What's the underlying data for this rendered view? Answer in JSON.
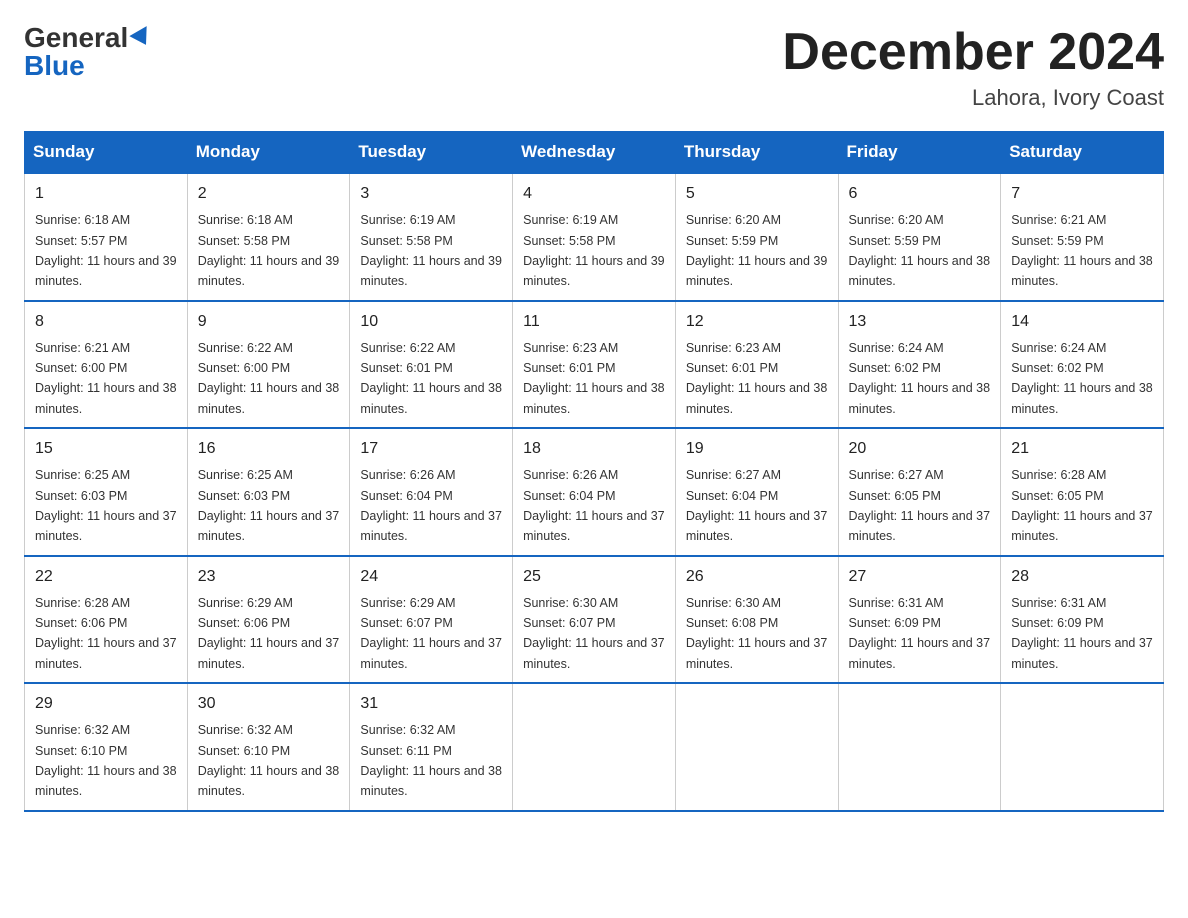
{
  "header": {
    "logo_general": "General",
    "logo_blue": "Blue",
    "month_title": "December 2024",
    "location": "Lahora, Ivory Coast"
  },
  "weekdays": [
    "Sunday",
    "Monday",
    "Tuesday",
    "Wednesday",
    "Thursday",
    "Friday",
    "Saturday"
  ],
  "weeks": [
    [
      {
        "day": "1",
        "sunrise": "6:18 AM",
        "sunset": "5:57 PM",
        "daylight": "11 hours and 39 minutes."
      },
      {
        "day": "2",
        "sunrise": "6:18 AM",
        "sunset": "5:58 PM",
        "daylight": "11 hours and 39 minutes."
      },
      {
        "day": "3",
        "sunrise": "6:19 AM",
        "sunset": "5:58 PM",
        "daylight": "11 hours and 39 minutes."
      },
      {
        "day": "4",
        "sunrise": "6:19 AM",
        "sunset": "5:58 PM",
        "daylight": "11 hours and 39 minutes."
      },
      {
        "day": "5",
        "sunrise": "6:20 AM",
        "sunset": "5:59 PM",
        "daylight": "11 hours and 39 minutes."
      },
      {
        "day": "6",
        "sunrise": "6:20 AM",
        "sunset": "5:59 PM",
        "daylight": "11 hours and 38 minutes."
      },
      {
        "day": "7",
        "sunrise": "6:21 AM",
        "sunset": "5:59 PM",
        "daylight": "11 hours and 38 minutes."
      }
    ],
    [
      {
        "day": "8",
        "sunrise": "6:21 AM",
        "sunset": "6:00 PM",
        "daylight": "11 hours and 38 minutes."
      },
      {
        "day": "9",
        "sunrise": "6:22 AM",
        "sunset": "6:00 PM",
        "daylight": "11 hours and 38 minutes."
      },
      {
        "day": "10",
        "sunrise": "6:22 AM",
        "sunset": "6:01 PM",
        "daylight": "11 hours and 38 minutes."
      },
      {
        "day": "11",
        "sunrise": "6:23 AM",
        "sunset": "6:01 PM",
        "daylight": "11 hours and 38 minutes."
      },
      {
        "day": "12",
        "sunrise": "6:23 AM",
        "sunset": "6:01 PM",
        "daylight": "11 hours and 38 minutes."
      },
      {
        "day": "13",
        "sunrise": "6:24 AM",
        "sunset": "6:02 PM",
        "daylight": "11 hours and 38 minutes."
      },
      {
        "day": "14",
        "sunrise": "6:24 AM",
        "sunset": "6:02 PM",
        "daylight": "11 hours and 38 minutes."
      }
    ],
    [
      {
        "day": "15",
        "sunrise": "6:25 AM",
        "sunset": "6:03 PM",
        "daylight": "11 hours and 37 minutes."
      },
      {
        "day": "16",
        "sunrise": "6:25 AM",
        "sunset": "6:03 PM",
        "daylight": "11 hours and 37 minutes."
      },
      {
        "day": "17",
        "sunrise": "6:26 AM",
        "sunset": "6:04 PM",
        "daylight": "11 hours and 37 minutes."
      },
      {
        "day": "18",
        "sunrise": "6:26 AM",
        "sunset": "6:04 PM",
        "daylight": "11 hours and 37 minutes."
      },
      {
        "day": "19",
        "sunrise": "6:27 AM",
        "sunset": "6:04 PM",
        "daylight": "11 hours and 37 minutes."
      },
      {
        "day": "20",
        "sunrise": "6:27 AM",
        "sunset": "6:05 PM",
        "daylight": "11 hours and 37 minutes."
      },
      {
        "day": "21",
        "sunrise": "6:28 AM",
        "sunset": "6:05 PM",
        "daylight": "11 hours and 37 minutes."
      }
    ],
    [
      {
        "day": "22",
        "sunrise": "6:28 AM",
        "sunset": "6:06 PM",
        "daylight": "11 hours and 37 minutes."
      },
      {
        "day": "23",
        "sunrise": "6:29 AM",
        "sunset": "6:06 PM",
        "daylight": "11 hours and 37 minutes."
      },
      {
        "day": "24",
        "sunrise": "6:29 AM",
        "sunset": "6:07 PM",
        "daylight": "11 hours and 37 minutes."
      },
      {
        "day": "25",
        "sunrise": "6:30 AM",
        "sunset": "6:07 PM",
        "daylight": "11 hours and 37 minutes."
      },
      {
        "day": "26",
        "sunrise": "6:30 AM",
        "sunset": "6:08 PM",
        "daylight": "11 hours and 37 minutes."
      },
      {
        "day": "27",
        "sunrise": "6:31 AM",
        "sunset": "6:09 PM",
        "daylight": "11 hours and 37 minutes."
      },
      {
        "day": "28",
        "sunrise": "6:31 AM",
        "sunset": "6:09 PM",
        "daylight": "11 hours and 37 minutes."
      }
    ],
    [
      {
        "day": "29",
        "sunrise": "6:32 AM",
        "sunset": "6:10 PM",
        "daylight": "11 hours and 38 minutes."
      },
      {
        "day": "30",
        "sunrise": "6:32 AM",
        "sunset": "6:10 PM",
        "daylight": "11 hours and 38 minutes."
      },
      {
        "day": "31",
        "sunrise": "6:32 AM",
        "sunset": "6:11 PM",
        "daylight": "11 hours and 38 minutes."
      },
      null,
      null,
      null,
      null
    ]
  ]
}
